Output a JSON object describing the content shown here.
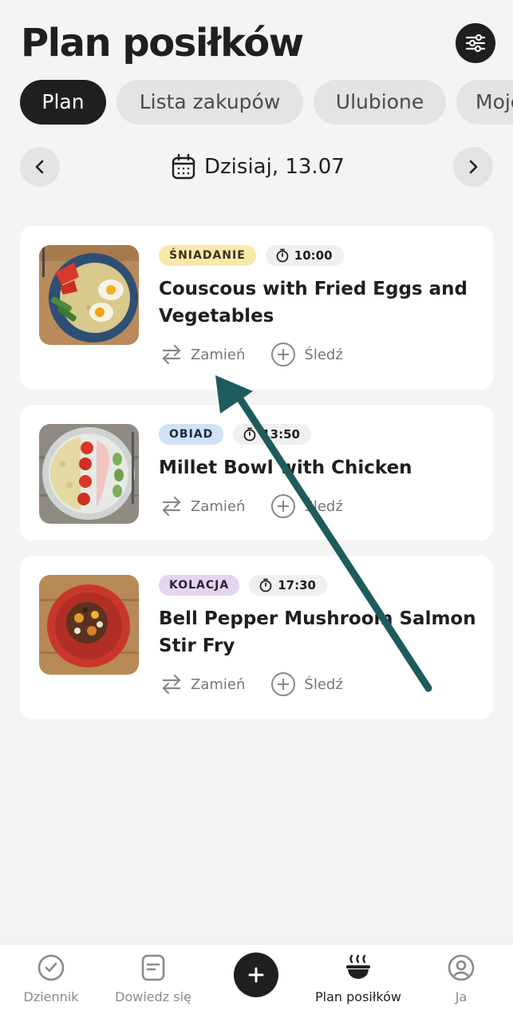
{
  "header": {
    "title": "Plan posiłków",
    "filter_icon": "sliders-icon"
  },
  "tabs": [
    {
      "label": "Plan",
      "active": true
    },
    {
      "label": "Lista zakupów",
      "active": false
    },
    {
      "label": "Ulubione",
      "active": false
    },
    {
      "label": "Moje",
      "active": false
    }
  ],
  "date_nav": {
    "label": "Dzisiaj, 13.07",
    "prev_icon": "chevron-left-icon",
    "next_icon": "chevron-right-icon",
    "calendar_icon": "calendar-icon"
  },
  "meals": [
    {
      "badge": "ŚNIADANIE",
      "badge_bg": "#fbe8a8",
      "badge_color": "#3a3220",
      "time": "10:00",
      "title": "Couscous with Fried Eggs and Vegetables",
      "swap_label": "Zamień",
      "track_label": "Śledź"
    },
    {
      "badge": "OBIAD",
      "badge_bg": "#cfe2f8",
      "badge_color": "#1e2a3a",
      "time": "13:50",
      "title": "Millet Bowl with Chicken",
      "swap_label": "Zamień",
      "track_label": "Śledź"
    },
    {
      "badge": "KOLACJA",
      "badge_bg": "#e4d6ee",
      "badge_color": "#2e2236",
      "time": "17:30",
      "title": "Bell Pepper Mushroom Salmon Stir Fry",
      "swap_label": "Zamień",
      "track_label": "Śledź"
    }
  ],
  "bottom_nav": [
    {
      "label": "Dziennik",
      "icon": "check-circle-icon",
      "active": false
    },
    {
      "label": "Dowiedz się",
      "icon": "article-icon",
      "active": false
    },
    {
      "label": "",
      "icon": "plus-icon",
      "active": false
    },
    {
      "label": "Plan posiłków",
      "icon": "meal-bowl-icon",
      "active": true
    },
    {
      "label": "Ja",
      "icon": "user-circle-icon",
      "active": false
    }
  ],
  "annotation": {
    "arrow_color": "#1e5b5c"
  }
}
